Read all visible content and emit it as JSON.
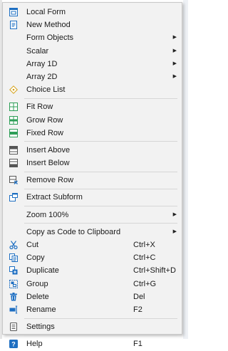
{
  "menu": {
    "items": [
      {
        "label": "Local Form",
        "icon": "local-form-icon"
      },
      {
        "label": "New Method",
        "icon": "new-method-icon"
      },
      {
        "label": "Form Objects",
        "submenu": true
      },
      {
        "label": "Scalar",
        "submenu": true
      },
      {
        "label": "Array 1D",
        "submenu": true
      },
      {
        "label": "Array 2D",
        "submenu": true
      },
      {
        "label": "Choice List",
        "icon": "choice-list-icon"
      },
      {
        "label": "Fit Row",
        "icon": "fit-row-icon"
      },
      {
        "label": "Grow Row",
        "icon": "grow-row-icon"
      },
      {
        "label": "Fixed Row",
        "icon": "fixed-row-icon"
      },
      {
        "label": "Insert Above",
        "icon": "insert-above-icon"
      },
      {
        "label": "Insert Below",
        "icon": "insert-below-icon"
      },
      {
        "label": "Remove Row",
        "icon": "remove-row-icon"
      },
      {
        "label": "Extract Subform",
        "icon": "extract-subform-icon"
      },
      {
        "label": "Zoom 100%",
        "submenu": true
      },
      {
        "label": "Copy as Code to Clipboard",
        "submenu": true
      },
      {
        "label": "Cut",
        "icon": "scissors-icon",
        "shortcut": "Ctrl+X"
      },
      {
        "label": "Copy",
        "icon": "copy-icon",
        "shortcut": "Ctrl+C"
      },
      {
        "label": "Duplicate",
        "icon": "duplicate-icon",
        "shortcut": "Ctrl+Shift+D"
      },
      {
        "label": "Group",
        "icon": "group-icon",
        "shortcut": "Ctrl+G"
      },
      {
        "label": "Delete",
        "icon": "trash-icon",
        "shortcut": "Del"
      },
      {
        "label": "Rename",
        "icon": "rename-icon",
        "shortcut": "F2"
      },
      {
        "label": "Settings",
        "icon": "settings-icon"
      },
      {
        "label": "Help",
        "icon": "help-icon",
        "shortcut": "F1"
      }
    ]
  },
  "colors": {
    "icon_blue": "#1e6fc2",
    "icon_green": "#2e9e57",
    "menu_bg": "#f2f2f2",
    "separator": "#d6d6d6"
  }
}
